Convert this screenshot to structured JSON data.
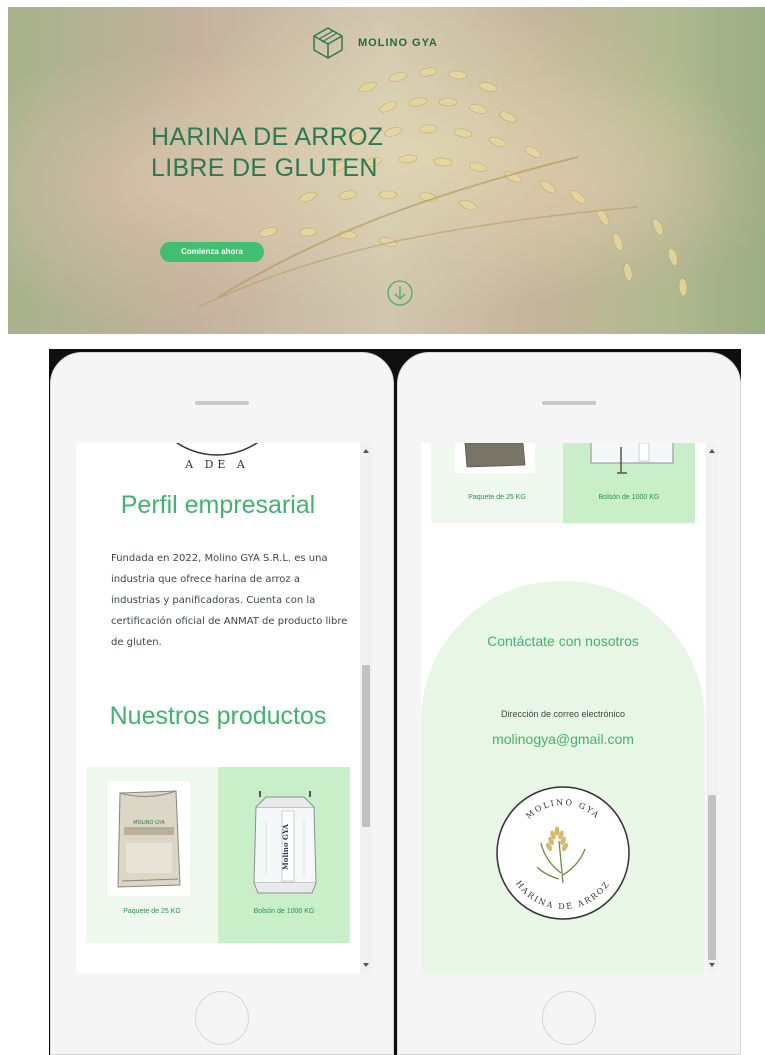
{
  "hero": {
    "brand": "MOLINO GYA",
    "title_line1": "HARINA DE ARROZ",
    "title_line2": "LIBRE DE GLUTEN",
    "cta_label": "Comienza ahora"
  },
  "left_phone": {
    "seal_fragment": "A  DE  A",
    "perfil_title": "Perfil empresarial",
    "perfil_text": "Fundada en 2022, Molino GYA S.R.L. es una industria que ofrece harina de arroz a industrias y panificadoras. Cuenta con la certificación oficial de ANMAT de producto libre de gluten.",
    "productos_title": "Nuestros productos",
    "products": [
      {
        "label": "Paquete de 25 KG",
        "bag_text": "MOLINO GYA"
      },
      {
        "label": "Bolsón de 1000 KG",
        "bag_text": "Molino GYA"
      }
    ]
  },
  "right_phone": {
    "products": [
      {
        "label": "Paquete de 25 KG"
      },
      {
        "label": "Bolsón de 1000 KG"
      }
    ],
    "contact_title": "Contáctate con nosotros",
    "email_label": "Dirección de correo electrónico",
    "email": "molinogya@gmail.com",
    "seal_top_text": "MOLINO GYA",
    "seal_bottom_text": "HARINA DE ARROZ"
  },
  "colors": {
    "brand_green": "#3fb56c",
    "dark_green": "#2a7a55",
    "card_light": "#eef8ec",
    "card_green": "#c8efc8"
  }
}
